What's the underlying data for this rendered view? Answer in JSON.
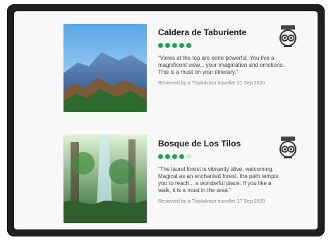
{
  "cards": [
    {
      "title": "Caldera de Taburiente",
      "rating": {
        "value": 5,
        "max": 5
      },
      "review": "“Views at the top are eerie powerful. You live a magnificent view... your imagination and emotions. This is a must on your itinerary.”",
      "meta": "Reviewed by a TripAdvisor traveller 21 Sep 2020",
      "badge_icon": "tripadvisor-badge-icon",
      "image_icon": "mountain-landscape-image"
    },
    {
      "title": "Bosque de Los Tilos",
      "rating": {
        "value": 4,
        "max": 5
      },
      "review": "“The laurel forest is vibrantly alive, welcoming. Magical as an enchanted forest, the path tempts you to reach... a wonderful place. If you like a walk, it is a must in the area.”",
      "meta": "Reviewed by a TripAdvisor traveller 17 Sep 2020",
      "badge_icon": "tripadvisor-badge-icon",
      "image_icon": "forest-waterfall-image"
    }
  ],
  "colors": {
    "device": "#1f1f1f",
    "screen": "#f8f8f8",
    "rating_on": "#18a558",
    "rating_off": "#cfe9d8"
  }
}
